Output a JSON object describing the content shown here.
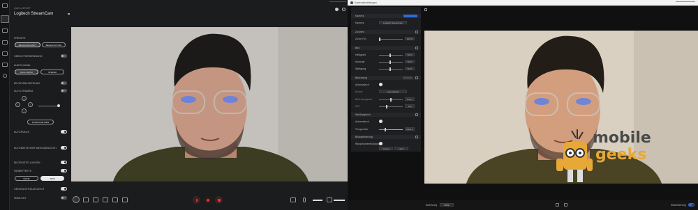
{
  "left_app": {
    "rail_icons": [
      "camera-icon",
      "image-icon",
      "brush-icon",
      "video-icon",
      "audio-icon",
      "layout-icon",
      "user-icon"
    ],
    "breadcrumb": "QUELLGERÄT",
    "device_name": "Logitech StreamCam",
    "section_presets": "PRESETS",
    "pill_framing": "BILDAUSSCHNITT",
    "pill_lighting": "BELEUCHTUNG",
    "toggle_face": "GESICHTSERKENNUNG",
    "section_audio": "AUDIO-KANAL",
    "pill_dual_mono": "DUAL-MONO",
    "pill_stereo": "STEREO",
    "toggle_picture": "BILDSTABILISIERUNG",
    "toggle_autoframe": "AUTO-FRAMING",
    "reset_button": "ZURÜCKSETZEN",
    "toggle_autofocus": "AUTOFOKUS",
    "toggle_auto_white": "AUTOMATISCHER WEISSABGLEICH",
    "toggle_image_settings": "BILDEINSTELLUNGEN",
    "toggle_filter": "FARBEFFEKTE",
    "pill_none": "KEINE",
    "pill_any": "JEDE",
    "toggle_hdr": "GEGENLICHTAUSGLEICH",
    "toggle_hdmi": "HDMI-OUT",
    "window_icons": [
      "moon-icon",
      "gear-icon"
    ]
  },
  "right_app": {
    "window_title": "Kameraeinstellungen",
    "panel_header": "VORSCHAUEN",
    "sec_camera": "Kamera",
    "camera_select_label": "Kamera",
    "camera_select_value": "Logitech StreamCam",
    "sec_zoom": "Zoomen",
    "zoom_label": "Zoom (%)",
    "zoom_value": "100 %",
    "sec_image": "Bild",
    "bright_label": "Helligkeit",
    "bright_value": "50 %",
    "contrast_label": "Kontrast",
    "contrast_value": "50 %",
    "saturation_label": "Sättigung",
    "saturation_value": "50 %",
    "sec_exposure": "Belichtung",
    "exposure_auto_label": "Automatisch",
    "exposure_mode_label": "Modus",
    "exposure_mode_value": "Automatisch",
    "shutter_label": "Belichtungszeit",
    "shutter_value": "1/30 s",
    "iso_label": "ISO",
    "iso_value": "100",
    "sec_white": "Weißabgleich",
    "white_auto_label": "Automatisch",
    "temp_label": "Temperatur",
    "temp_value": "5000 K",
    "sec_extra": "Bildoptimierung",
    "extra_label": "Rauschunterdrückung",
    "extra_val_a": "Gering",
    "extra_val_b": "Hoch",
    "footer_label": "Auflösung",
    "footer_value": "1080p",
    "footer_toggle_label": "Stabilisierung"
  },
  "watermark": {
    "line1": "mobile",
    "line2": "geeks"
  }
}
